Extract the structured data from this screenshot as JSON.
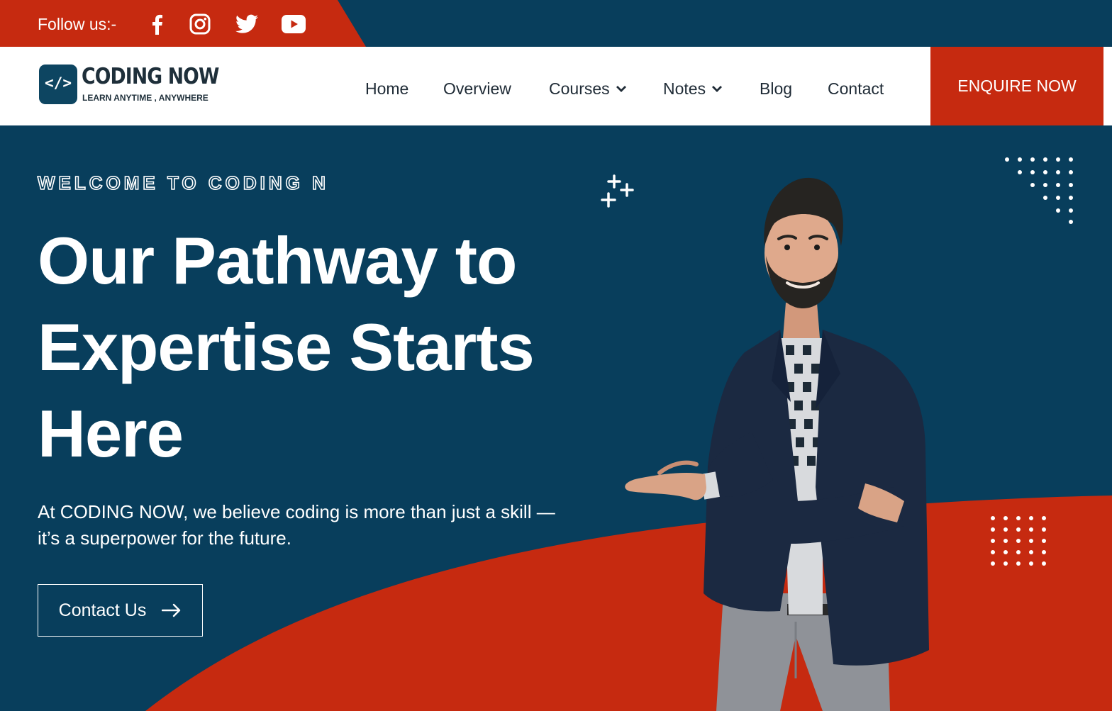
{
  "topbar": {
    "follow_label": "Follow us:-",
    "social_icons": [
      "facebook-icon",
      "instagram-icon",
      "twitter-icon",
      "youtube-icon"
    ]
  },
  "header": {
    "logo": {
      "icon": "</>",
      "name": "CODING NOW",
      "tagline": "LEARN ANYTIME ,  ANYWHERE"
    },
    "nav": {
      "home": "Home",
      "overview": "Overview",
      "courses": "Courses",
      "notes": "Notes",
      "blog": "Blog",
      "contact": "Contact"
    },
    "enquire": "ENQUIRE NOW"
  },
  "hero": {
    "kicker": "WELCOME TO CODING N",
    "title_lines": [
      "Our Pathway to",
      "Expertise Starts",
      "Here"
    ],
    "description_lines": [
      "At CODING NOW, we believe coding is more than just a skill —",
      "it’s a superpower for the future."
    ],
    "cta": "Contact Us"
  },
  "colors": {
    "navy": "#083e5c",
    "accent_red": "#c62a10",
    "white": "#ffffff",
    "nav_text": "#1f2b36"
  }
}
